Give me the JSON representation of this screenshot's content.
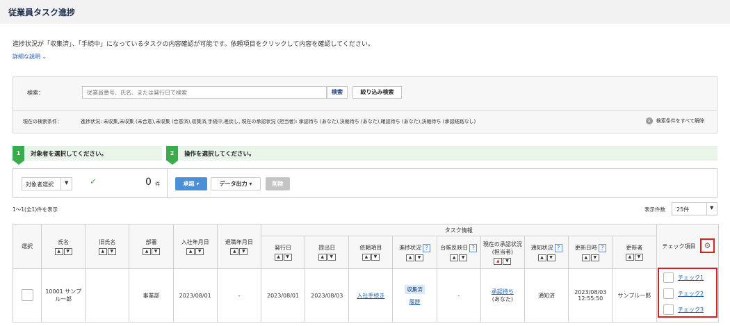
{
  "page": {
    "title": "従業員タスク進捗"
  },
  "description": "進捗状況が「収集済」、「手続中」になっているタスクの内容確認が可能です。依頼項目をクリックして内容を確認してください。",
  "detail_link": "詳細な説明",
  "search": {
    "label": "検索：",
    "placeholder": "従業員番号、氏名、または発行日で検索",
    "button": "検索",
    "narrow_button": "絞り込み検索",
    "condition_label": "現在の検索条件：",
    "condition_text": "進捗状況: 未収集,未収集 (未合意),未収集 (合意済),収集済,手続中,差戻し, 現在の承認状況 (担当者): 承認待ち (あなた),決裁待ち (あなた),確認待ち (あなた),決裁待ち (承認経路なし)",
    "clear_all": "検索条件をすべて解除"
  },
  "steps": [
    {
      "num": "1",
      "text": "対象者を選択してください。"
    },
    {
      "num": "2",
      "text": "操作を選択してください。"
    }
  ],
  "actions": {
    "target_select": "対象者選択",
    "count": "0",
    "count_unit": "件",
    "approve": "承認",
    "export": "データ出力",
    "delete": "削除"
  },
  "list": {
    "range": "1〜1(全1)件を表示",
    "per_page_label": "表示件数",
    "per_page": "25件"
  },
  "table": {
    "group_header": "タスク情報",
    "headers": {
      "select": "選択",
      "name": "氏名",
      "old_name": "旧氏名",
      "dept": "部署",
      "join_date": "入社年月日",
      "leave_date": "退職年月日",
      "issue_date": "発行日",
      "submit_date": "提出日",
      "request_item": "依頼項目",
      "progress": "進捗状況",
      "ledger": "台帳反映日",
      "approval": "現在の承認状況 (担当者)",
      "notice": "通知状況",
      "updated_at": "更新日時",
      "updater": "更新者",
      "check_items": "チェック項目"
    },
    "row": {
      "name": "10001 サンプル一郎",
      "old_name": "",
      "dept": "事業部",
      "join_date": "2023/08/01",
      "leave_date": "-",
      "issue_date": "2023/08/01",
      "submit_date": "2023/08/03",
      "request_item": "入社手続き",
      "progress_tag": "収集済",
      "progress_link": "履歴",
      "ledger": "-",
      "approval_link": "承認待ち",
      "approval_who": "(あなた)",
      "notice": "通知済",
      "updated_at": "2023/08/03 12:55:50",
      "updater": "サンプル一郎",
      "checks": [
        "チェック1",
        "チェック2",
        "チェック3"
      ]
    }
  }
}
